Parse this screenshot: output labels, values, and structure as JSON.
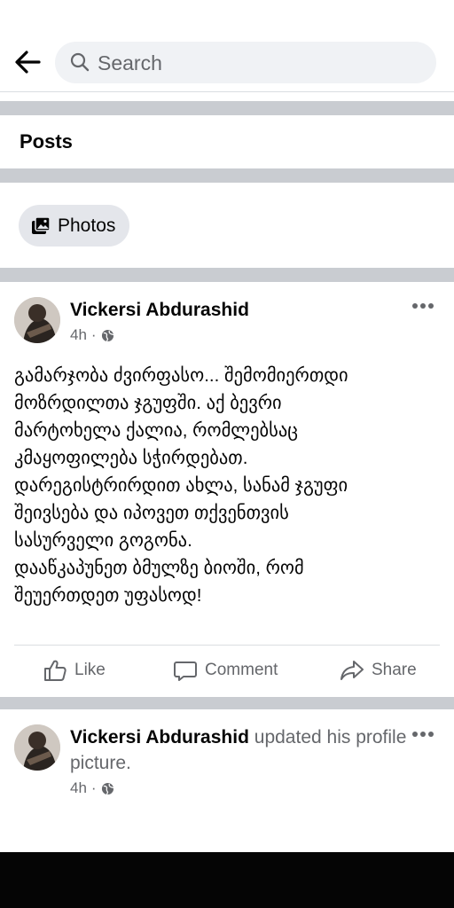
{
  "search": {
    "placeholder": "Search"
  },
  "section": {
    "title": "Posts"
  },
  "filter_chip": {
    "label": "Photos"
  },
  "post1": {
    "author": "Vickersi Abdurashid",
    "time": "4h",
    "lines": [
      "გამარჯობა ძვირფასო... შემომიერთდი",
      "მოზრდილთა ჯგუფში. აქ ბევრი",
      "მარტოხელა ქალია, რომლებსაც",
      "კმაყოფილება სჭირდებათ.",
      "დარეგისტრირდით ახლა, სანამ ჯგუფი",
      "შეივსება და იპოვეთ თქვენთვის",
      "სასურველი გოგონა.",
      "დააწკაპუნეთ ბმულზე ბიოში, რომ",
      "შეუერთდეთ უფასოდ!"
    ],
    "actions": {
      "like": "Like",
      "comment": "Comment",
      "share": "Share"
    }
  },
  "post2": {
    "author": "Vickersi Abdurashid",
    "text": "updated his profile picture.",
    "time": "4h"
  },
  "icons": [
    "back-arrow-icon",
    "search-icon",
    "photos-icon",
    "globe-icon",
    "more-icon",
    "like-icon",
    "comment-icon",
    "share-icon"
  ],
  "colors": {
    "divider": "#c9ccd1",
    "secondary_text": "#65676b",
    "chip_bg": "#e4e6eb",
    "search_bg": "#f0f2f5"
  }
}
